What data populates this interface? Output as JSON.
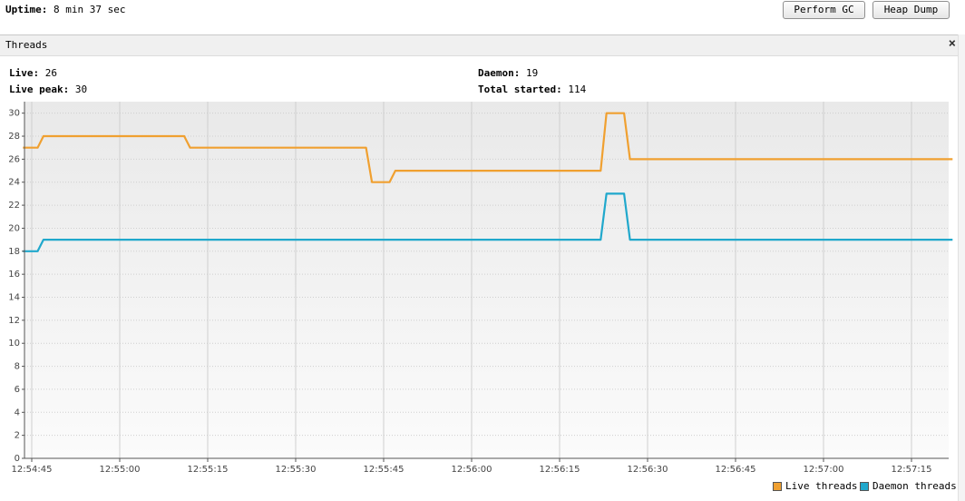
{
  "header": {
    "uptime_label": "Uptime:",
    "uptime_value": "8 min 37 sec",
    "perform_gc": "Perform GC",
    "heap_dump": "Heap Dump"
  },
  "panel": {
    "title": "Threads",
    "close": "×"
  },
  "stats": {
    "live_label": "Live:",
    "live_value": "26",
    "live_peak_label": "Live peak:",
    "live_peak_value": "30",
    "daemon_label": "Daemon:",
    "daemon_value": "19",
    "total_label": "Total started:",
    "total_value": "114"
  },
  "colors": {
    "live": "#f0a030",
    "daemon": "#20a8cc"
  },
  "chart_data": {
    "type": "line",
    "x_ticks": [
      "12:54:45",
      "12:55:00",
      "12:55:15",
      "12:55:30",
      "12:55:45",
      "12:56:00",
      "12:56:15",
      "12:56:30",
      "12:56:45",
      "12:57:00",
      "12:57:15"
    ],
    "y_ticks": [
      "0",
      "2",
      "4",
      "6",
      "8",
      "10",
      "12",
      "14",
      "16",
      "18",
      "20",
      "22",
      "24",
      "26",
      "28",
      "30"
    ],
    "ylim": [
      0,
      31
    ],
    "xlim_seconds_from_12_54_45": [
      -1.5,
      157
    ],
    "series": [
      {
        "name": "Live threads",
        "color": "#f0a030",
        "points": [
          [
            -1.5,
            27
          ],
          [
            1,
            27
          ],
          [
            2,
            28
          ],
          [
            26,
            28
          ],
          [
            27,
            27
          ],
          [
            57,
            27
          ],
          [
            58,
            24
          ],
          [
            61,
            24
          ],
          [
            62,
            25
          ],
          [
            97,
            25
          ],
          [
            98,
            30
          ],
          [
            101,
            30
          ],
          [
            102,
            26
          ],
          [
            157,
            26
          ]
        ]
      },
      {
        "name": "Daemon threads",
        "color": "#20a8cc",
        "points": [
          [
            -1.5,
            18
          ],
          [
            1,
            18
          ],
          [
            2,
            19
          ],
          [
            97,
            19
          ],
          [
            98,
            23
          ],
          [
            101,
            23
          ],
          [
            102,
            19
          ],
          [
            157,
            19
          ]
        ]
      }
    ]
  }
}
